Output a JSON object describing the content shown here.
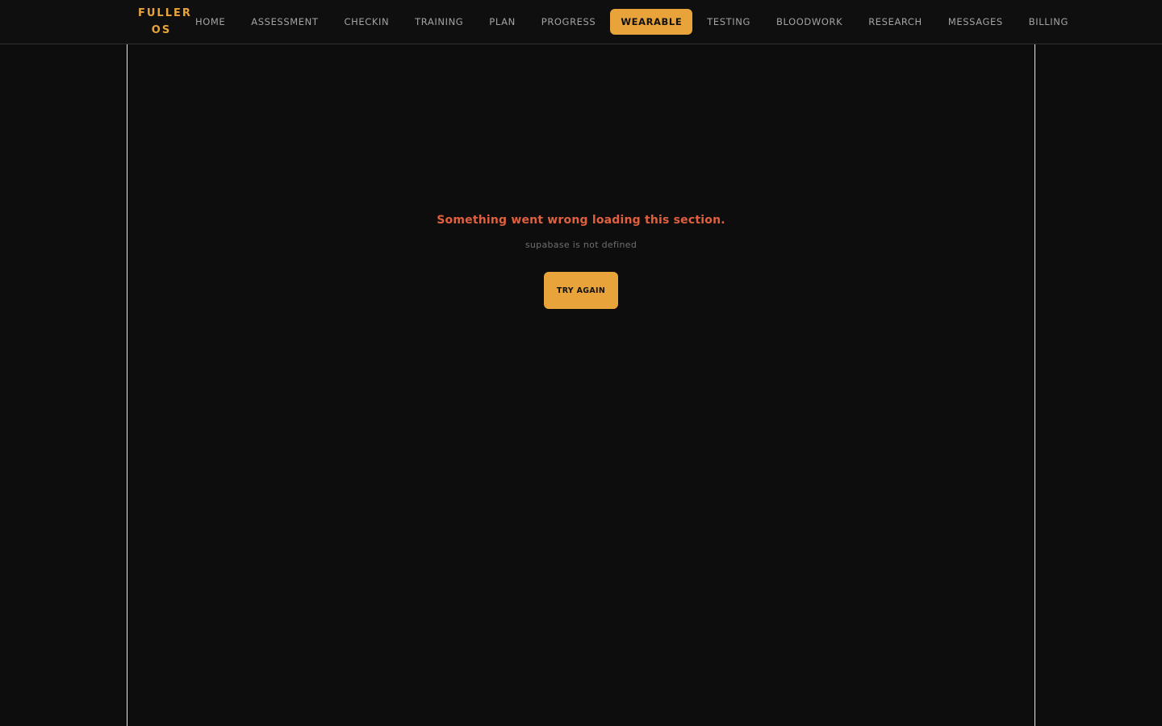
{
  "brand": {
    "line1": "FULLER",
    "line2": "OS"
  },
  "nav": {
    "items": [
      {
        "label": "HOME"
      },
      {
        "label": "ASSESSMENT"
      },
      {
        "label": "CHECKIN"
      },
      {
        "label": "TRAINING"
      },
      {
        "label": "PLAN"
      },
      {
        "label": "PROGRESS"
      },
      {
        "label": "WEARABLE",
        "active": true
      },
      {
        "label": "TESTING"
      },
      {
        "label": "BLOODWORK"
      },
      {
        "label": "RESEARCH"
      },
      {
        "label": "MESSAGES"
      },
      {
        "label": "BILLING"
      }
    ]
  },
  "error": {
    "title": "Something went wrong loading this section.",
    "detail": "supabase is not defined",
    "retry_label": "TRY AGAIN"
  },
  "colors": {
    "accent": "#e8a43a",
    "error": "#e0603e",
    "background": "#0d0d0e"
  }
}
